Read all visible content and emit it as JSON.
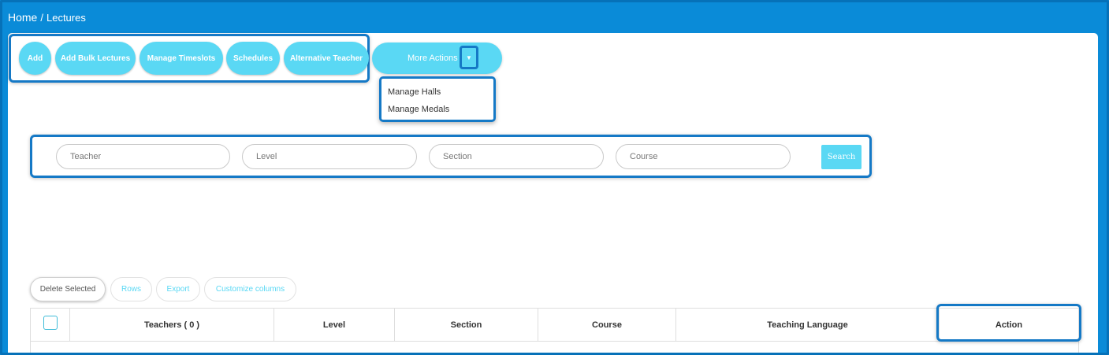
{
  "breadcrumb": {
    "home": "Home",
    "separator": "/",
    "current": "Lectures"
  },
  "actions": {
    "add": "Add",
    "add_bulk": "Add Bulk Lectures",
    "manage_timeslots": "Manage Timeslots",
    "schedules": "Schedules",
    "alternative_teacher": "Alternative Teacher",
    "more_actions": "More Actions"
  },
  "more_actions_menu": {
    "items": [
      "Manage Halls",
      "Manage Medals"
    ]
  },
  "filters": {
    "teacher_placeholder": "Teacher",
    "level_placeholder": "Level",
    "section_placeholder": "Section",
    "course_placeholder": "Course",
    "search_label": "Search"
  },
  "table_toolbar": {
    "delete_selected": "Delete Selected",
    "rows": "Rows",
    "export": "Export",
    "customize_columns": "Customize columns"
  },
  "table": {
    "columns": [
      "Teachers ( 0 )",
      "Level",
      "Section",
      "Course",
      "Teaching Language",
      "Action"
    ]
  },
  "colors": {
    "background": "#0a8bd8",
    "accent": "#5ad8f4",
    "highlight": "#1579c6"
  },
  "icons": {
    "caret": "caret-down-icon"
  }
}
